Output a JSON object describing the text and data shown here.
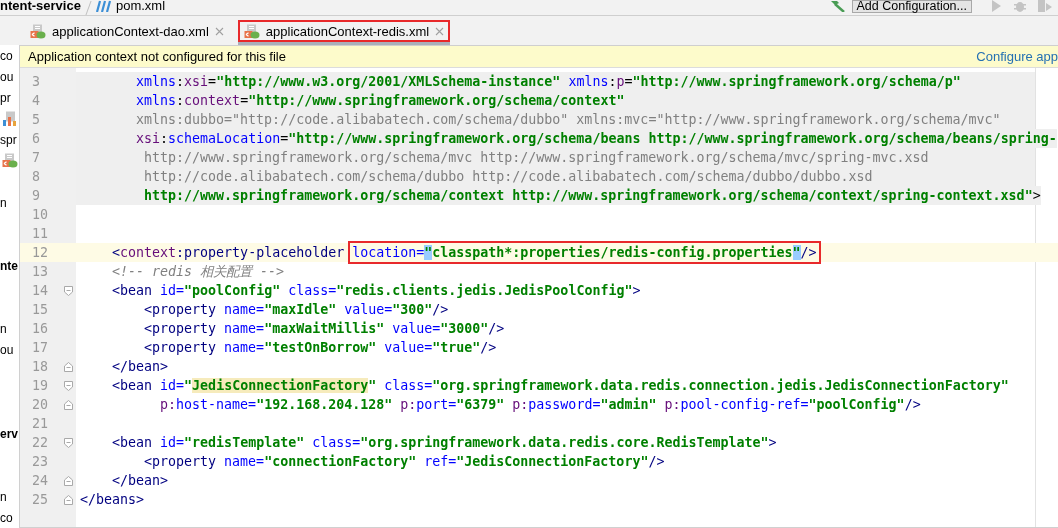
{
  "breadcrumbs": [
    {
      "kind": "module",
      "text": "ntent-service"
    },
    {
      "kind": "maven",
      "text": "pom.xml"
    }
  ],
  "toolbar": {
    "button": "Add Configuration..."
  },
  "sidebar": {
    "items": [
      {
        "kind": "text",
        "text": "co",
        "bold": false
      },
      {
        "kind": "text",
        "text": "ou",
        "bold": false
      },
      {
        "kind": "text",
        "text": "pr",
        "bold": false
      },
      {
        "kind": "chart"
      },
      {
        "kind": "text",
        "text": "spr",
        "bold": false
      },
      {
        "kind": "xml"
      },
      {
        "kind": "text",
        "text": "n",
        "bold": false
      },
      {
        "kind": "text",
        "text": "nte",
        "bold": true
      },
      {
        "kind": "text",
        "text": "n",
        "bold": false
      },
      {
        "kind": "text",
        "text": "ou",
        "bold": false
      },
      {
        "kind": "text",
        "text": "erv",
        "bold": true
      },
      {
        "kind": "text",
        "text": "n",
        "bold": false
      },
      {
        "kind": "text",
        "text": "co",
        "bold": false
      }
    ]
  },
  "tabs": [
    {
      "label": "applicationContext-dao.xml",
      "selected": false,
      "annotated": false
    },
    {
      "label": "applicationContext-redis.xml",
      "selected": true,
      "annotated": true
    }
  ],
  "banner": {
    "message": "Application context not configured for this file",
    "link": "Configure app"
  },
  "editor": {
    "lines": [
      {
        "n": "3",
        "kind": "plain",
        "shaded": true,
        "current": false,
        "tokens": [
          {
            "kind": "attr",
            "text": "       xmlns"
          },
          {
            "kind": "plain",
            "text": ":"
          },
          {
            "kind": "ns",
            "text": "xsi"
          },
          {
            "kind": "plain",
            "text": "="
          },
          {
            "kind": "value",
            "text": "\"http://www.w3.org/2001/XMLSchema-instance\" "
          },
          {
            "kind": "attr",
            "text": "xmlns"
          },
          {
            "kind": "plain",
            "text": ":"
          },
          {
            "kind": "ns",
            "text": "p"
          },
          {
            "kind": "plain",
            "text": "="
          },
          {
            "kind": "value",
            "text": "\"http://www.springframework.org/schema/p\""
          }
        ]
      },
      {
        "n": "4",
        "kind": "plain",
        "shaded": true,
        "current": false,
        "tokens": [
          {
            "kind": "attr",
            "text": "       xmlns"
          },
          {
            "kind": "plain",
            "text": ":"
          },
          {
            "kind": "ns",
            "text": "context"
          },
          {
            "kind": "plain",
            "text": "="
          },
          {
            "kind": "value",
            "text": "\"http://www.springframework.org/schema/context\""
          }
        ]
      },
      {
        "n": "5",
        "kind": "plain",
        "shaded": true,
        "current": false,
        "tokens": [
          {
            "kind": "dim",
            "text": "       xmlns:dubbo=\"http://code.alibabatech.com/schema/dubbo\" xmlns:mvc=\"http://www.springframework.org/schema/mvc\""
          }
        ]
      },
      {
        "n": "6",
        "kind": "plain",
        "shaded": true,
        "current": false,
        "tokens": [
          {
            "kind": "ns",
            "text": "       xsi"
          },
          {
            "kind": "plain",
            "text": ":"
          },
          {
            "kind": "attr",
            "text": "schemaLocation"
          },
          {
            "kind": "plain",
            "text": "="
          },
          {
            "kind": "value",
            "text": "\"http://www.springframework.org/schema/beans http://www.springframework.org/schema/beans/spring-"
          }
        ]
      },
      {
        "n": "7",
        "kind": "plain",
        "shaded": true,
        "current": false,
        "tokens": [
          {
            "kind": "dim",
            "text": "        http://www.springframework.org/schema/mvc http://www.springframework.org/schema/mvc/spring-mvc.xsd"
          }
        ]
      },
      {
        "n": "8",
        "kind": "plain",
        "shaded": true,
        "current": false,
        "tokens": [
          {
            "kind": "dim",
            "text": "        http://code.alibabatech.com/schema/dubbo http://code.alibabatech.com/schema/dubbo/dubbo.xsd"
          }
        ]
      },
      {
        "n": "9",
        "kind": "plain",
        "shaded": true,
        "current": false,
        "tokens": [
          {
            "kind": "value",
            "text": "        http://www.springframework.org/schema/context http://www.springframework.org/schema/context/spring-context.xsd\""
          },
          {
            "kind": "plain",
            "text": ">"
          }
        ]
      },
      {
        "n": "10",
        "kind": "plain",
        "shaded": false,
        "current": false
      },
      {
        "n": "11",
        "kind": "plain",
        "shaded": false,
        "current": false
      },
      {
        "n": "12",
        "kind": "plain",
        "shaded": false,
        "current": true,
        "tokens": [
          {
            "kind": "tag",
            "text": "    <"
          },
          {
            "kind": "ns",
            "text": "context"
          },
          {
            "kind": "tag",
            "text": ":property-placeholder "
          }
        ],
        "boxed_tokens": [
          {
            "kind": "attr",
            "text": "location"
          },
          {
            "kind": "attr",
            "text": "="
          },
          {
            "kind": "match",
            "text": "\""
          },
          {
            "kind": "value",
            "text": "classpath*:properties/redis-config.properties"
          },
          {
            "kind": "match",
            "text": "\""
          },
          {
            "kind": "tag",
            "text": "/>"
          }
        ]
      },
      {
        "n": "13",
        "kind": "plain",
        "shaded": false,
        "current": false,
        "tokens": [
          {
            "kind": "comment",
            "text": "    <!-- redis 相关配置 -->"
          }
        ]
      },
      {
        "n": "14",
        "kind": "opener",
        "shaded": false,
        "current": false,
        "tokens": [
          {
            "kind": "tag",
            "text": "    <bean "
          },
          {
            "kind": "attr",
            "text": "id="
          },
          {
            "kind": "value",
            "text": "\"poolConfig\" "
          },
          {
            "kind": "attr",
            "text": "class="
          },
          {
            "kind": "value",
            "text": "\"redis.clients.jedis.JedisPoolConfig\""
          },
          {
            "kind": "tag",
            "text": ">"
          }
        ]
      },
      {
        "n": "15",
        "kind": "plain",
        "shaded": false,
        "current": false,
        "tokens": [
          {
            "kind": "tag",
            "text": "        <property "
          },
          {
            "kind": "attr",
            "text": "name="
          },
          {
            "kind": "value",
            "text": "\"maxIdle\" "
          },
          {
            "kind": "attr",
            "text": "value="
          },
          {
            "kind": "value",
            "text": "\"300\""
          },
          {
            "kind": "tag",
            "text": "/>"
          }
        ]
      },
      {
        "n": "16",
        "kind": "plain",
        "shaded": false,
        "current": false,
        "tokens": [
          {
            "kind": "tag",
            "text": "        <property "
          },
          {
            "kind": "attr",
            "text": "name="
          },
          {
            "kind": "value",
            "text": "\"maxWaitMillis\" "
          },
          {
            "kind": "attr",
            "text": "value="
          },
          {
            "kind": "value",
            "text": "\"3000\""
          },
          {
            "kind": "tag",
            "text": "/>"
          }
        ]
      },
      {
        "n": "17",
        "kind": "plain",
        "shaded": false,
        "current": false,
        "tokens": [
          {
            "kind": "tag",
            "text": "        <property "
          },
          {
            "kind": "attr",
            "text": "name="
          },
          {
            "kind": "value",
            "text": "\"testOnBorrow\" "
          },
          {
            "kind": "attr",
            "text": "value="
          },
          {
            "kind": "value",
            "text": "\"true\""
          },
          {
            "kind": "tag",
            "text": "/>"
          }
        ]
      },
      {
        "n": "18",
        "kind": "closer",
        "shaded": false,
        "current": false,
        "tokens": [
          {
            "kind": "tag",
            "text": "    </bean>"
          }
        ]
      },
      {
        "n": "19",
        "kind": "opener",
        "shaded": false,
        "current": false,
        "tokens": [
          {
            "kind": "tag",
            "text": "    <bean "
          },
          {
            "kind": "attr",
            "text": "id="
          },
          {
            "kind": "value",
            "text": "\""
          },
          {
            "kind": "ref",
            "text": "JedisConnectionFactory"
          },
          {
            "kind": "value",
            "text": "\" "
          },
          {
            "kind": "attr",
            "text": "class="
          },
          {
            "kind": "value",
            "text": "\"org.springframework.data.redis.connection.jedis.JedisConnectionFactory\""
          }
        ]
      },
      {
        "n": "20",
        "kind": "closer",
        "shaded": false,
        "current": false,
        "tokens": [
          {
            "kind": "ns",
            "text": "          p:"
          },
          {
            "kind": "attr",
            "text": "host-name="
          },
          {
            "kind": "value",
            "text": "\"192.168.204.128\" "
          },
          {
            "kind": "ns",
            "text": "p:"
          },
          {
            "kind": "attr",
            "text": "port="
          },
          {
            "kind": "value",
            "text": "\"6379\" "
          },
          {
            "kind": "ns",
            "text": "p:"
          },
          {
            "kind": "attr",
            "text": "password="
          },
          {
            "kind": "value",
            "text": "\"admin\" "
          },
          {
            "kind": "ns",
            "text": "p:"
          },
          {
            "kind": "attr",
            "text": "pool-config-ref="
          },
          {
            "kind": "value",
            "text": "\"poolConfig\""
          },
          {
            "kind": "tag",
            "text": "/>"
          }
        ]
      },
      {
        "n": "21",
        "kind": "plain",
        "shaded": false,
        "current": false
      },
      {
        "n": "22",
        "kind": "opener",
        "shaded": false,
        "current": false,
        "tokens": [
          {
            "kind": "tag",
            "text": "    <bean "
          },
          {
            "kind": "attr",
            "text": "id="
          },
          {
            "kind": "value",
            "text": "\"redisTemplate\" "
          },
          {
            "kind": "attr",
            "text": "class="
          },
          {
            "kind": "value",
            "text": "\"org.springframework.data.redis.core.RedisTemplate\""
          },
          {
            "kind": "tag",
            "text": ">"
          }
        ]
      },
      {
        "n": "23",
        "kind": "plain",
        "shaded": false,
        "current": false,
        "tokens": [
          {
            "kind": "tag",
            "text": "        <property "
          },
          {
            "kind": "attr",
            "text": "name="
          },
          {
            "kind": "value",
            "text": "\"connectionFactory\" "
          },
          {
            "kind": "attr",
            "text": "ref="
          },
          {
            "kind": "value",
            "text": "\"JedisConnectionFactory\""
          },
          {
            "kind": "tag",
            "text": "/>"
          }
        ]
      },
      {
        "n": "24",
        "kind": "closer",
        "shaded": false,
        "current": false,
        "tokens": [
          {
            "kind": "tag",
            "text": "    </bean>"
          }
        ]
      },
      {
        "n": "25",
        "kind": "closer",
        "shaded": false,
        "current": false,
        "tokens": [
          {
            "kind": "tag",
            "text": "</beans>"
          }
        ]
      }
    ]
  }
}
